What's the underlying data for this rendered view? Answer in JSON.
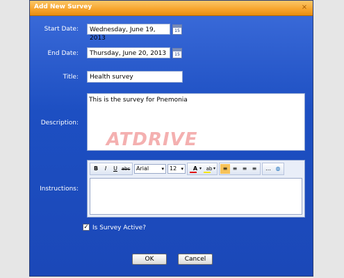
{
  "dialog": {
    "title": "Add New Survey",
    "close_glyph": "×"
  },
  "form": {
    "start_date_label": "Start Date:",
    "start_date_value": "Wednesday, June 19, 2013",
    "end_date_label": "End Date:",
    "end_date_value": "Thursday, June 20, 2013",
    "calendar_day": "15",
    "title_label": "Title:",
    "title_value": "Health survey",
    "description_label": "Description:",
    "description_value": "This is the survey for Pnemonia",
    "instructions_label": "Instructions:",
    "active_label": "Is Survey Active?",
    "active_checked": true
  },
  "editor_toolbar": {
    "bold": "B",
    "italic": "I",
    "underline": "U",
    "strike": "abc",
    "font_family": "Arial",
    "font_size": "12",
    "font_color_letter": "A",
    "highlight_letter": "ab"
  },
  "watermark_text": "ATDRIVE",
  "buttons": {
    "ok": "OK",
    "cancel": "Cancel"
  },
  "colors": {
    "titlebar": "#f7a630",
    "dialog_bg": "#1d4fc2",
    "font_color_bar": "#e01010",
    "highlight_bar": "#f5e600"
  },
  "icons": {
    "calendar": "calendar-icon",
    "close": "close-icon",
    "checkbox": "checkmark-icon"
  }
}
